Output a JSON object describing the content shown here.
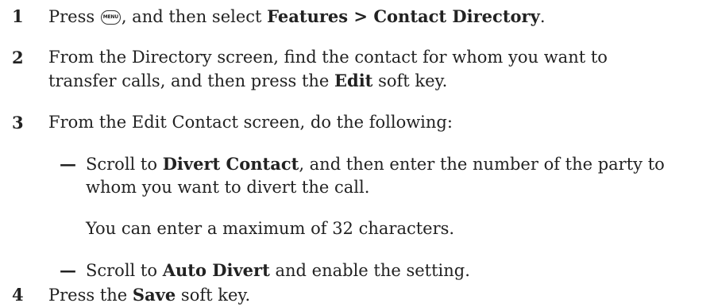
{
  "steps": [
    {
      "number": "1",
      "parts": {
        "a": "Press ",
        "icon_label": "MENU",
        "b": ", and then select ",
        "bold": "Features > Contact Directory",
        "c": "."
      }
    },
    {
      "number": "2",
      "parts": {
        "line1": "From the Directory screen, find the contact for whom you want to",
        "a": "transfer calls, and then press the ",
        "bold": "Edit",
        "b": " soft key."
      }
    },
    {
      "number": "3",
      "parts": {
        "a": "From the Edit Contact screen, do the following:"
      }
    },
    {
      "number": "4",
      "parts": {
        "a": "Press the ",
        "bold": "Save",
        "b": " soft key."
      }
    }
  ],
  "substeps": [
    {
      "dash": "—",
      "a": "Scroll to ",
      "bold": "Divert Contact",
      "b": ", and then enter the number of the party to",
      "line2": "whom you want to divert the call."
    },
    {
      "dash": "—",
      "a": "Scroll to ",
      "bold": "Auto Divert",
      "b": " and enable the setting."
    }
  ],
  "note": "You can enter a maximum of 32 characters.",
  "icons": {
    "menu_key": "menu-key-icon"
  }
}
